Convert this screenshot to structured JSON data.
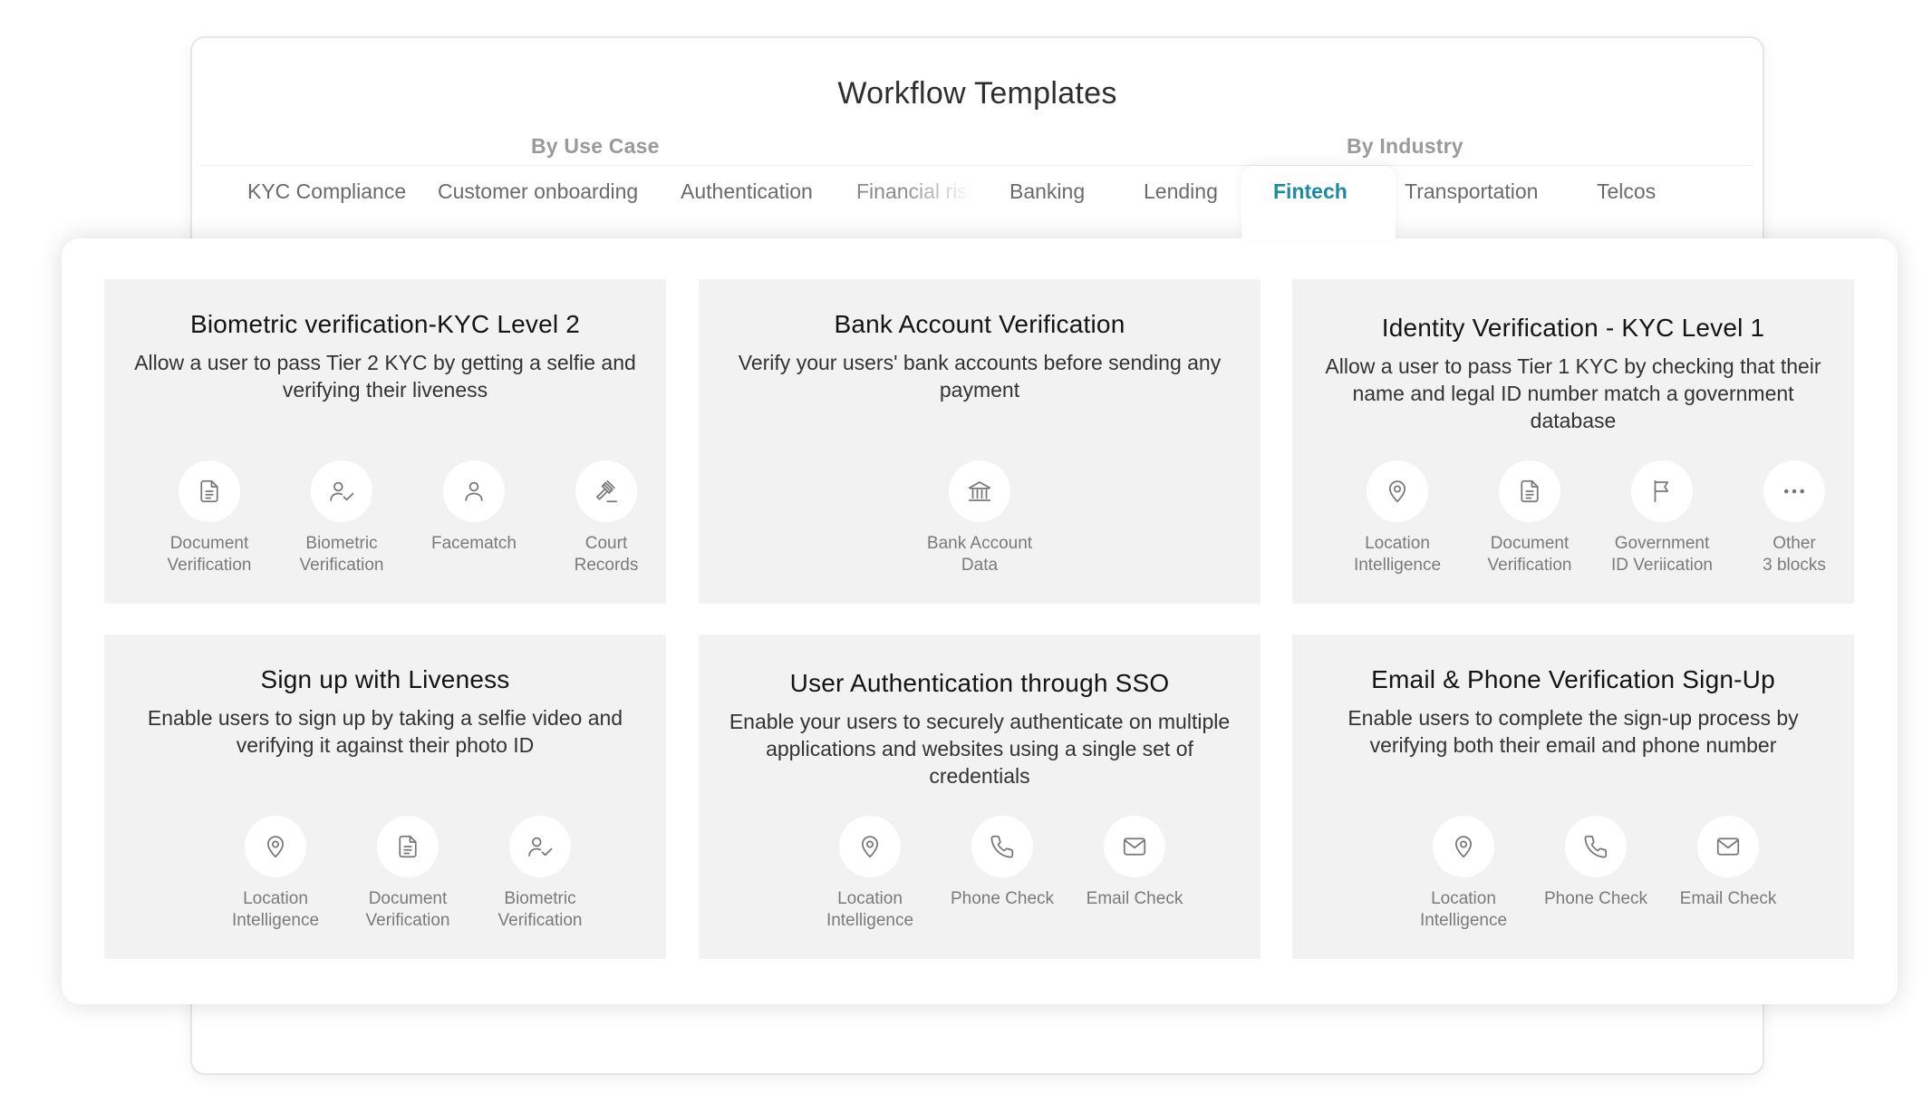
{
  "header": {
    "title": "Workflow Templates",
    "by_use_case": "By Use Case",
    "by_industry": "By Industry"
  },
  "tabs": {
    "use_case": [
      "KYC Compliance",
      "Customer onboarding",
      "Authentication",
      "Financial risk"
    ],
    "industry": [
      "Banking",
      "Lending",
      "Fintech",
      "Transportation",
      "Telcos"
    ],
    "active": "Fintech"
  },
  "accent_color": "#1e8aa0",
  "cards": [
    {
      "title": "Biometric verification-KYC Level 2",
      "description": "Allow a user to pass Tier 2 KYC by getting a selfie and verifying their liveness",
      "blocks": [
        {
          "icon": "document-icon",
          "label": "Document\nVerification"
        },
        {
          "icon": "user-check-icon",
          "label": "Biometric\nVerification"
        },
        {
          "icon": "user-icon",
          "label": "Facematch"
        },
        {
          "icon": "gavel-icon",
          "label": "Court\nRecords"
        }
      ]
    },
    {
      "title": "Bank Account Verification",
      "description": "Verify your users' bank accounts before sending any payment",
      "blocks": [
        {
          "icon": "bank-icon",
          "label": "Bank Account\nData"
        }
      ]
    },
    {
      "title": "Identity Verification - KYC Level 1",
      "description": "Allow a user to pass Tier 1 KYC by checking that their name and legal ID number match a government database",
      "blocks": [
        {
          "icon": "location-pin-icon",
          "label": "Location\nIntelligence"
        },
        {
          "icon": "document-icon",
          "label": "Document\nVerification"
        },
        {
          "icon": "flag-icon",
          "label": "Government\nID Veriication"
        },
        {
          "icon": "more-dots-icon",
          "label": "Other\n3 blocks"
        }
      ]
    },
    {
      "title": "Sign up with Liveness",
      "description": "Enable users to sign up by taking a selfie video and verifying it against their photo ID",
      "blocks": [
        {
          "icon": "location-pin-icon",
          "label": "Location\nIntelligence"
        },
        {
          "icon": "document-icon",
          "label": "Document\nVerification"
        },
        {
          "icon": "user-check-icon",
          "label": "Biometric\nVerification"
        }
      ]
    },
    {
      "title": "User Authentication through SSO",
      "description": "Enable your users to securely authenticate on multiple applications and websites using a single set of credentials",
      "blocks": [
        {
          "icon": "location-pin-icon",
          "label": "Location\nIntelligence"
        },
        {
          "icon": "phone-icon",
          "label": "Phone Check"
        },
        {
          "icon": "mail-icon",
          "label": "Email Check"
        }
      ]
    },
    {
      "title": "Email & Phone Verification Sign-Up",
      "description": "Enable users to complete the sign-up process by verifying both their email and phone number",
      "blocks": [
        {
          "icon": "location-pin-icon",
          "label": "Location\nIntelligence"
        },
        {
          "icon": "phone-icon",
          "label": "Phone Check"
        },
        {
          "icon": "mail-icon",
          "label": "Email Check"
        }
      ]
    }
  ]
}
